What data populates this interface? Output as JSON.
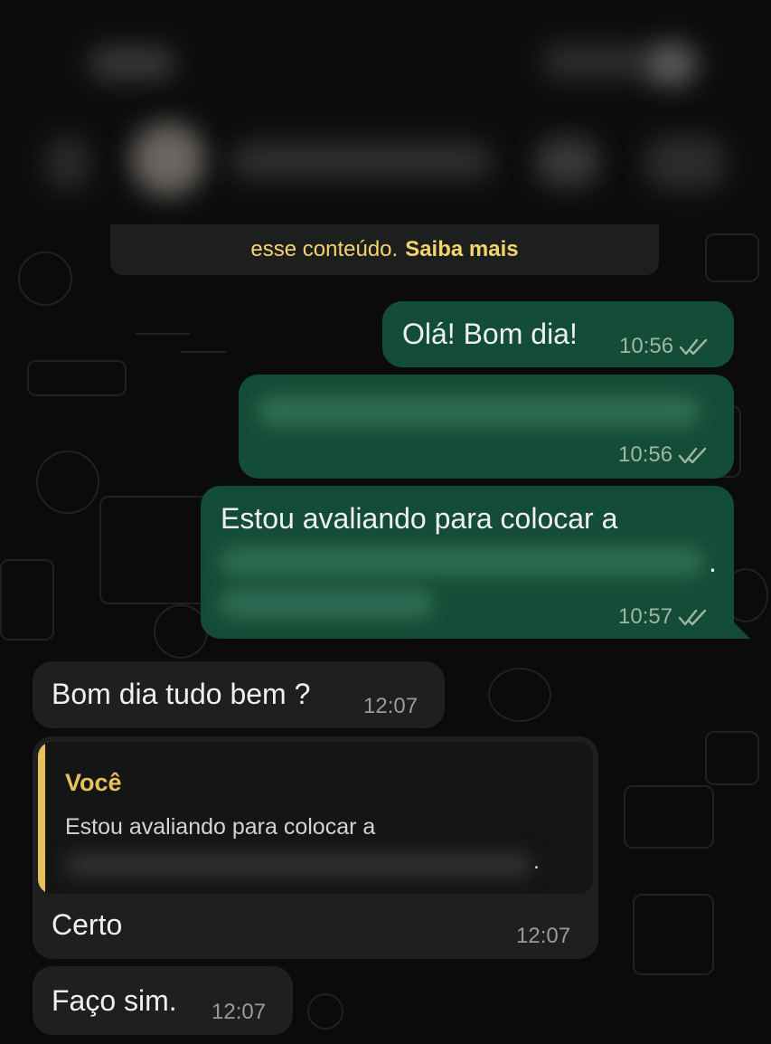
{
  "notice": {
    "text": "esse conteúdo.",
    "link": "Saiba mais"
  },
  "messages": {
    "m1": {
      "text": "Olá! Bom dia!",
      "time": "10:56",
      "status": "read"
    },
    "m2": {
      "time": "10:56",
      "status": "read"
    },
    "m3": {
      "text": "Estou avaliando para colocar a",
      "trailing": ".",
      "time": "10:57",
      "status": "read"
    },
    "m4": {
      "text": "Bom dia tudo bem ?",
      "time": "12:07"
    },
    "m5": {
      "quote_author": "Você",
      "quote_text": "Estou avaliando para colocar a",
      "quote_trailing": ".",
      "text": "Certo",
      "time": "12:07"
    },
    "m6": {
      "text": "Faço sim.",
      "time": "12:07"
    }
  },
  "icons": {
    "read_receipt": "double-check-icon"
  },
  "colors": {
    "outgoing_bubble": "#144d37",
    "incoming_bubble": "#1f1f1f",
    "accent_yellow": "#e8c15c",
    "background": "#0b0b0c"
  }
}
